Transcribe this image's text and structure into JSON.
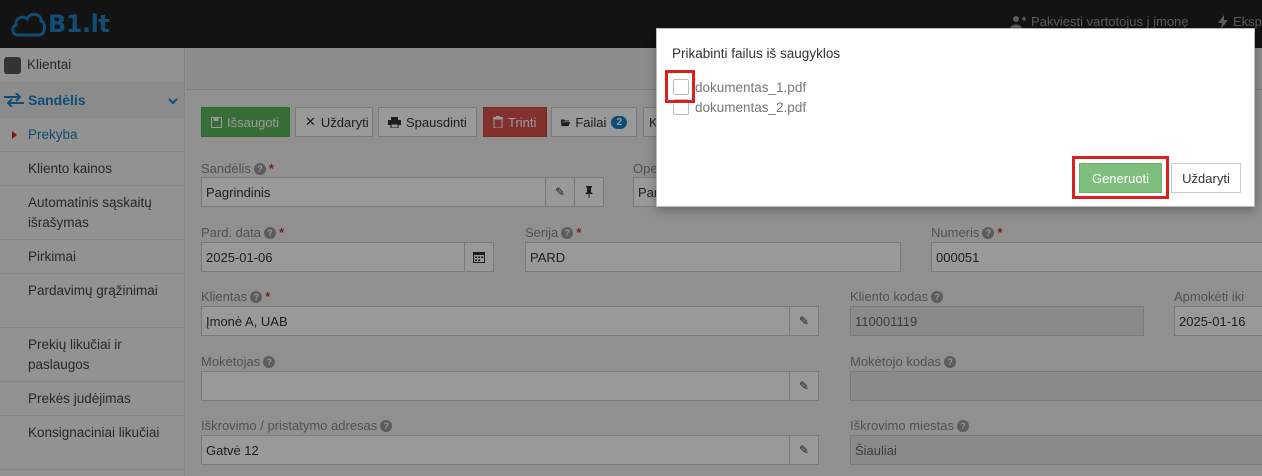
{
  "topbar": {
    "logo": "B1.lt",
    "invite_link": "Pakviesti vartotojus į įmonę",
    "export_link": "Eksp"
  },
  "sidebar": {
    "clients": "Klientai",
    "section": "Sandėlis",
    "items": [
      {
        "label": "Prekyba"
      },
      {
        "label": "Kliento kainos"
      },
      {
        "label": "Automatinis sąskaitų išrašymas"
      },
      {
        "label": "Pirkimai"
      },
      {
        "label": "Pardavimų grąžinimai"
      },
      {
        "label": "Prekių likučiai ir paslaugos"
      },
      {
        "label": "Prekės judėjimas"
      },
      {
        "label": "Konsignaciniai likučiai"
      }
    ]
  },
  "toolbar": {
    "save": "Išsaugoti",
    "close": "Uždaryti",
    "print": "Spausdinti",
    "delete": "Trinti",
    "files": "Failai",
    "files_count": "2",
    "more": "K"
  },
  "form": {
    "warehouse_label": "Sandėlis",
    "warehouse_value": "Pagrindinis",
    "operation_label": "Ope",
    "operation_value": "Par",
    "date_label": "Pard. data",
    "date_value": "2025-01-06",
    "series_label": "Serija",
    "series_value": "PARD",
    "number_label": "Numeris",
    "number_value": "000051",
    "client_label": "Klientas",
    "client_value": "Įmonė A, UAB",
    "client_code_label": "Kliento kodas",
    "client_code_value": "110001119",
    "pay_until_label": "Apmokėti iki",
    "pay_until_value": "2025-01-16",
    "payer_label": "Mokėtojas",
    "payer_value": "",
    "payer_code_label": "Mokėtojo kodas",
    "payer_code_value": "",
    "address_label": "Iškrovimo / pristatymo adresas",
    "address_value": "Gatvė 12",
    "city_label": "Iškrovimo miestas",
    "city_value": "Šiauliai"
  },
  "modal": {
    "title": "Prikabinti failus iš saugyklos",
    "files": [
      {
        "name": "dokumentas_1.pdf"
      },
      {
        "name": "dokumentas_2.pdf"
      }
    ],
    "generate": "Generuoti",
    "close": "Uždaryti"
  },
  "colors": {
    "accent": "#1b7fc1",
    "save": "#5cb85c",
    "delete": "#d9534f",
    "highlight": "#d9211e"
  }
}
